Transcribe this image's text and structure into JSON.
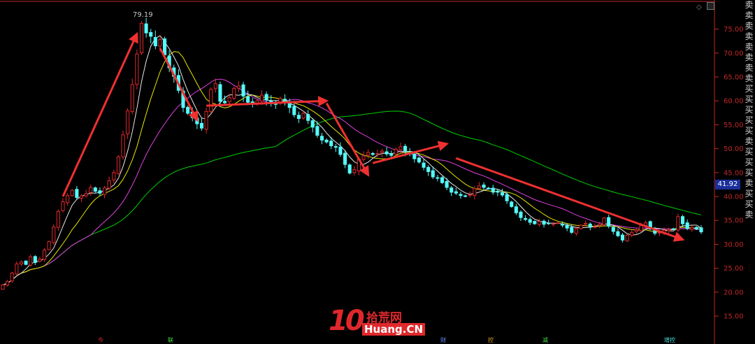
{
  "chart_data": {
    "type": "candlestick",
    "yaxis": {
      "ticks": [
        "75.00",
        "70.00",
        "65.00",
        "60.00",
        "55.00",
        "50.00",
        "45.00",
        "40.00",
        "35.00",
        "30.00",
        "25.00",
        "20.00",
        "15.00"
      ],
      "ylim": [
        11.5,
        80.5
      ]
    },
    "peak_label": "79.19",
    "last_price": "41.92",
    "colors": {
      "up": "#e0282c",
      "down": "#54fcfc",
      "ma5": "#e8e8e8",
      "ma10": "#e6e600",
      "ma20": "#e040e0",
      "ma60": "#00d000",
      "arrow": "#ee3030",
      "axis": "#c02828"
    },
    "closes": [
      21.5,
      22.2,
      24.0,
      25.9,
      26.3,
      25.8,
      27.4,
      26.2,
      26.9,
      28.8,
      30.6,
      33.6,
      36.9,
      38.9,
      40.2,
      41.3,
      39.8,
      40.1,
      40.6,
      41.9,
      41.1,
      40.7,
      41.8,
      43.3,
      45.0,
      48.3,
      52.9,
      57.9,
      63.4,
      69.8,
      76.2,
      74.2,
      73.5,
      71.5,
      72.8,
      69.6,
      66.9,
      65.1,
      62.2,
      58.6,
      57.4,
      56.5,
      55.2,
      54.3,
      57.8,
      62.4,
      63.6,
      59.9,
      59.6,
      60.7,
      62.6,
      63.1,
      61.0,
      59.7,
      59.6,
      60.0,
      61.2,
      60.2,
      59.4,
      59.3,
      60.5,
      59.8,
      58.6,
      57.1,
      56.3,
      57.4,
      55.9,
      54.5,
      52.8,
      51.8,
      51.4,
      50.6,
      50.3,
      48.8,
      46.7,
      44.9,
      45.6,
      47.8,
      48.5,
      49.2,
      48.8,
      49.0,
      49.5,
      48.9,
      48.6,
      49.9,
      50.4,
      49.4,
      48.9,
      47.9,
      47.2,
      46.1,
      45.2,
      44.1,
      43.9,
      42.9,
      41.9,
      40.9,
      40.7,
      40.2,
      40.1,
      40.4,
      41.7,
      42.2,
      41.9,
      41.7,
      40.9,
      40.9,
      40.3,
      39.1,
      37.9,
      36.6,
      35.6,
      35.2,
      34.6,
      34.3,
      34.8,
      34.2,
      34.4,
      34.3,
      34.5,
      34.0,
      33.4,
      32.5,
      33.3,
      34.0,
      34.4,
      33.6,
      33.7,
      34.2,
      35.5,
      33.8,
      32.7,
      31.8,
      30.9,
      31.9,
      32.5,
      33.0,
      33.9,
      34.5,
      33.2,
      32.3,
      32.5,
      32.9,
      33.1,
      33.2,
      35.8,
      34.3,
      33.3,
      33.5,
      33.2,
      32.6
    ],
    "series_labels": [],
    "bottom_markers": [
      {
        "label": "今",
        "color": "#e0282c"
      },
      {
        "label": "联",
        "color": "#40e040"
      },
      {
        "label": "财",
        "color": "#6a8cff"
      },
      {
        "label": "控",
        "color": "#e0a020"
      },
      {
        "label": "减",
        "color": "#40e040"
      },
      {
        "label": "增控",
        "color": "#40e0e0"
      }
    ]
  },
  "side_signals": [
    "卖",
    "卖",
    "卖",
    "卖",
    "卖",
    "卖",
    "卖",
    "卖",
    "买",
    "买",
    "买",
    "买",
    "买",
    "卖",
    "买",
    "买",
    "买",
    "卖",
    "买",
    "买",
    "卖"
  ],
  "logo": {
    "ten": "10",
    "cn": "拾荒网",
    "site": "Huang.CN"
  }
}
